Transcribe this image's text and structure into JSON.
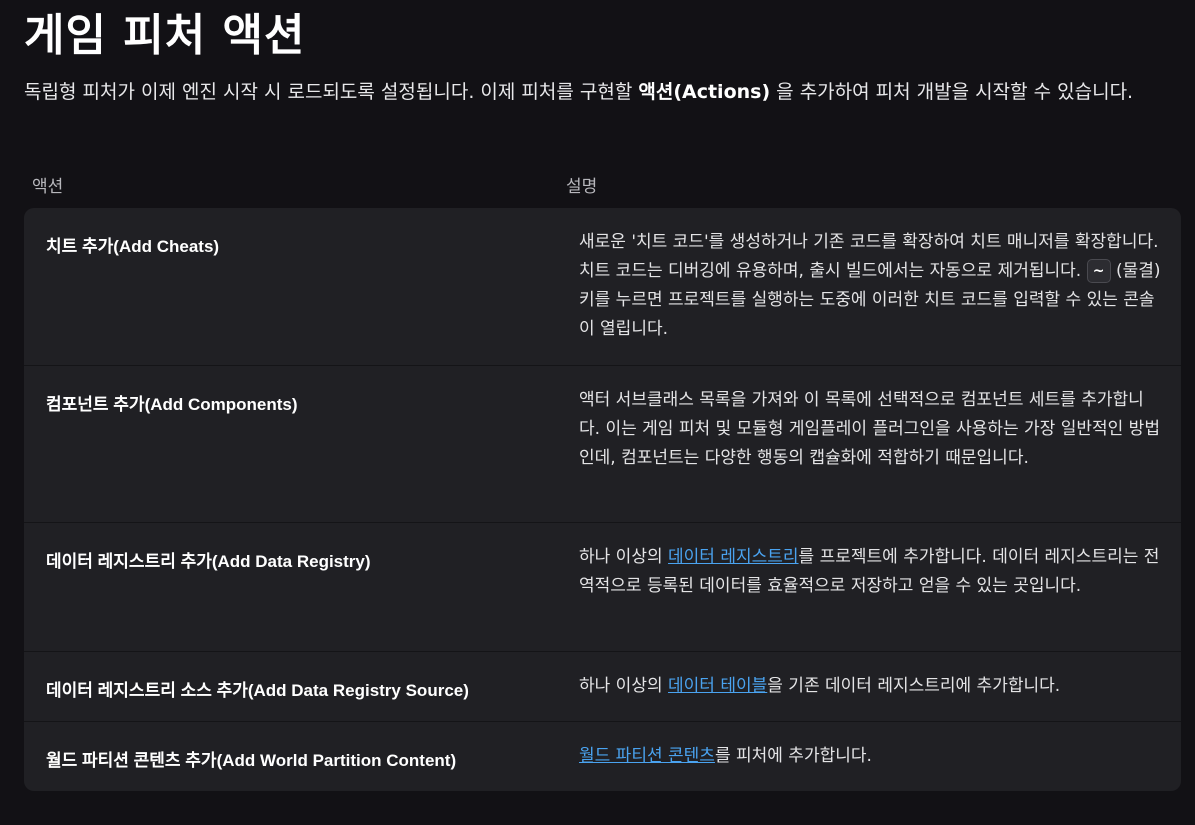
{
  "title": "게임 피처 액션",
  "intro": {
    "before": "독립형 피처가 이제 엔진 시작 시 로드되도록 설정됩니다. 이제 피처를 구현할 ",
    "bold": "액션(Actions)",
    "after": " 을 추가하여 피처 개발을 시작할 수 있습니다."
  },
  "table": {
    "headers": {
      "action": "액션",
      "description": "설명"
    },
    "rows": [
      {
        "name": "치트 추가(Add Cheats)",
        "desc_before": "새로운 '치트 코드'를 생성하거나 기존 코드를 확장하여 치트 매니저를 확장합니다. 치트 코드는 디버깅에 유용하며, 출시 빌드에서는 자동으로 제거됩니다. ",
        "kbd": "~",
        "desc_after": " (물결) 키를 누르면 프로젝트를 실행하는 도중에 이러한 치트 코드를 입력할 수 있는 콘솔이 열립니다."
      },
      {
        "name": "컴포넌트 추가(Add Components)",
        "desc": "액터 서브클래스 목록을 가져와 이 목록에 선택적으로 컴포넌트 세트를 추가합니다. 이는 게임 피처 및 모듈형 게임플레이 플러그인을 사용하는 가장 일반적인 방법인데, 컴포넌트는 다양한 행동의 캡슐화에 적합하기 때문입니다."
      },
      {
        "name": "데이터 레지스트리 추가(Add Data Registry)",
        "desc_before": "하나 이상의 ",
        "link": "데이터 레지스트리",
        "desc_after": "를 프로젝트에 추가합니다. 데이터 레지스트리는 전역적으로 등록된 데이터를 효율적으로 저장하고 얻을 수 있는 곳입니다."
      },
      {
        "name": "데이터 레지스트리 소스 추가(Add Data Registry Source)",
        "desc_before": "하나 이상의 ",
        "link": "데이터 테이블",
        "desc_after": "을 기존 데이터 레지스트리에 추가합니다."
      },
      {
        "name": "월드 파티션 콘텐츠 추가(Add World Partition Content)",
        "desc_before": "",
        "link": "월드 파티션 콘텐츠",
        "desc_after": "를 피처에 추가합니다."
      }
    ]
  },
  "colors": {
    "background": "#121115",
    "table_bg": "#202024",
    "link": "#4aa3f0"
  }
}
